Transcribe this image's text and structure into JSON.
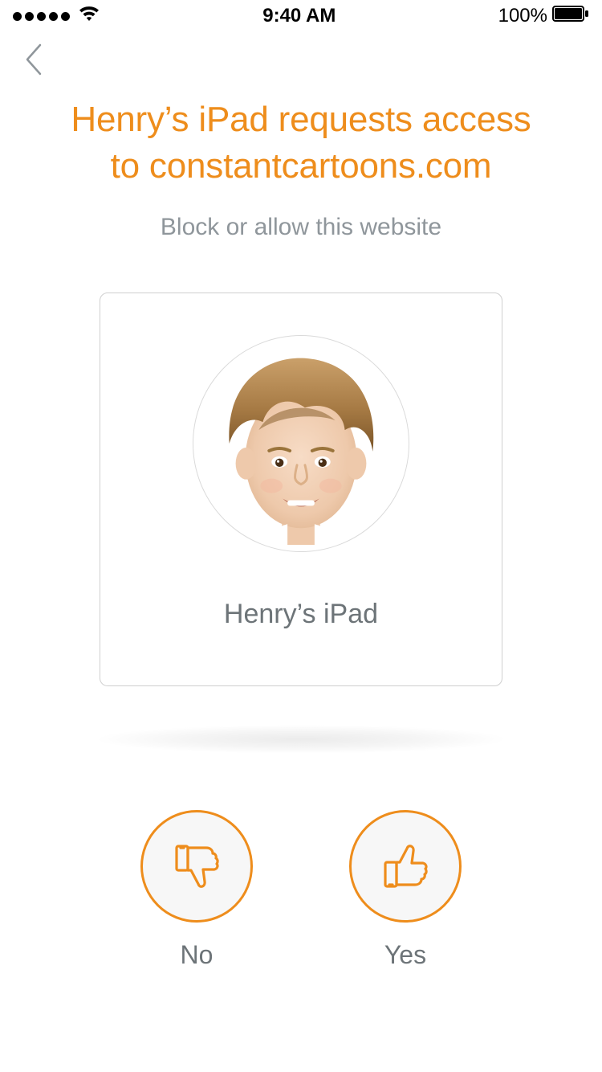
{
  "statusbar": {
    "time": "9:40 AM",
    "battery_text": "100%"
  },
  "header": {
    "title_line1": "Henry’s iPad requests access",
    "title_line2": "to constantcartoons.com",
    "subtitle": "Block or allow this website"
  },
  "card": {
    "device_label": "Henry’s iPad"
  },
  "actions": {
    "no_label": "No",
    "yes_label": "Yes"
  },
  "colors": {
    "accent": "#ee8d1c",
    "muted": "#8f969b"
  }
}
